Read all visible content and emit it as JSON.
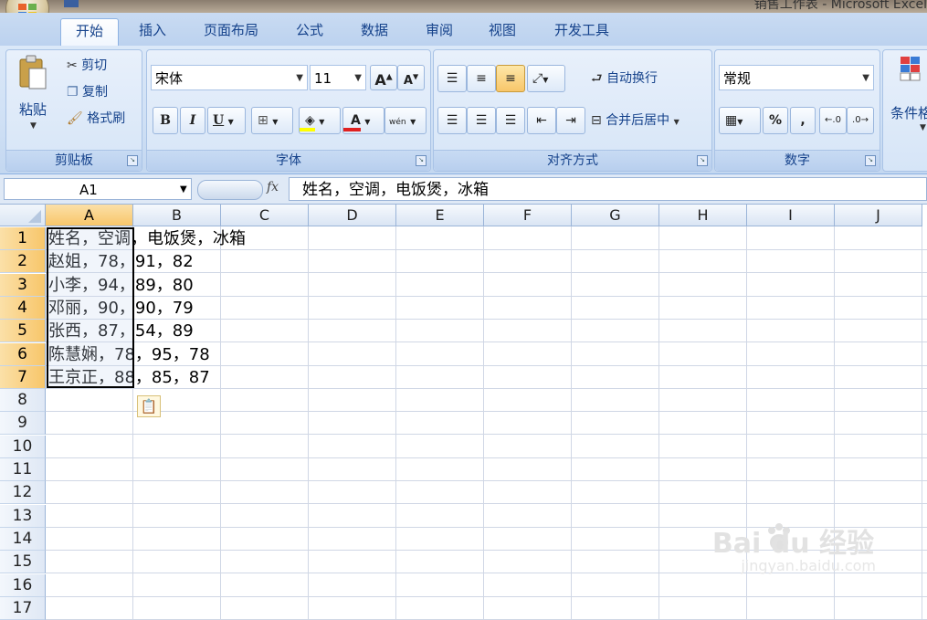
{
  "window": {
    "title": "销售工作表 - Microsoft Excel"
  },
  "ribbon_tabs": [
    "开始",
    "插入",
    "页面布局",
    "公式",
    "数据",
    "审阅",
    "视图",
    "开发工具"
  ],
  "clipboard": {
    "paste": "粘贴",
    "cut": "剪切",
    "copy": "复制",
    "format_painter": "格式刷",
    "label": "剪贴板"
  },
  "font": {
    "name": "宋体",
    "size": "11",
    "label": "字体",
    "bold": "B",
    "italic": "I",
    "underline": "U",
    "font_color_letter": "A",
    "phonetic": "wén"
  },
  "alignment": {
    "wrap": "自动换行",
    "merge": "合并后居中",
    "label": "对齐方式"
  },
  "number": {
    "format": "常规",
    "percent": "%",
    "comma": ",",
    "label": "数字"
  },
  "styles": {
    "cond_format": "条件格"
  },
  "formula_bar": {
    "name_box": "A1",
    "fx": "fx",
    "content": "姓名，空调，电饭煲，冰箱"
  },
  "columns": [
    "A",
    "B",
    "C",
    "D",
    "E",
    "F",
    "G",
    "H",
    "I",
    "J"
  ],
  "rows": [
    "1",
    "2",
    "3",
    "4",
    "5",
    "6",
    "7",
    "8",
    "9",
    "10",
    "11",
    "12",
    "13",
    "14",
    "15",
    "16",
    "17"
  ],
  "cells": [
    "姓名，空调，电饭煲，冰箱",
    "赵姐，78，91，82",
    "小李，94，89，80",
    "邓丽，90，90，79",
    "张西，87，54，89",
    "陈慧娴，78，95，78",
    "王京正，88，85，87"
  ],
  "watermark": {
    "brand": "Bai du 经验",
    "url": "jingyan.baidu.com"
  },
  "colors": {
    "selection": "#f8c66a",
    "ribbon": "#cfe0f5",
    "accent": "#15428b"
  }
}
